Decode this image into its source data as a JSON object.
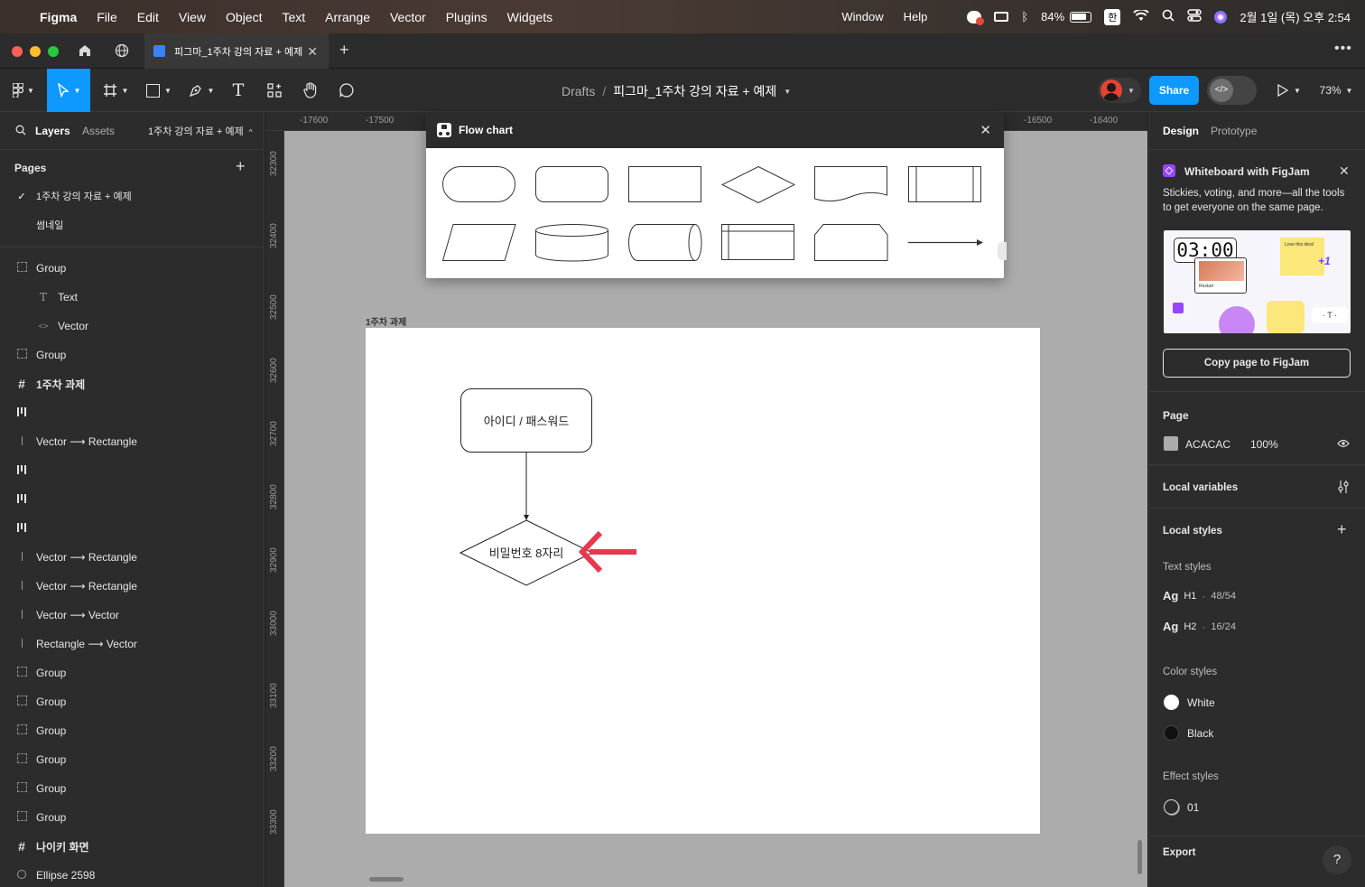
{
  "menubar": {
    "app": "Figma",
    "items": [
      "File",
      "Edit",
      "View",
      "Object",
      "Text",
      "Arrange",
      "Vector",
      "Plugins",
      "Widgets"
    ],
    "right_items": [
      "Window",
      "Help"
    ],
    "battery": "84%",
    "ime": "한",
    "datetime": "2월 1일 (목) 오후 2:54"
  },
  "tabs": {
    "active": "피그마_1주차 강의 자료 + 예제"
  },
  "toolbar": {
    "breadcrumb_root": "Drafts",
    "breadcrumb_sep": "/",
    "file_name": "피그마_1주차 강의 자료 + 예제",
    "share": "Share",
    "zoom": "73%"
  },
  "left": {
    "tab_layers": "Layers",
    "tab_assets": "Assets",
    "page_selector": "1주차 강의 자료 + 예제",
    "pages_title": "Pages",
    "pages": [
      "1주차 강의 자료 + 예제",
      "썸네일"
    ],
    "layers": [
      {
        "icon": "group-icon",
        "label": "Group",
        "indent": 0
      },
      {
        "icon": "text-icon",
        "label": "Text",
        "indent": 1
      },
      {
        "icon": "vector-icon",
        "label": "Vector",
        "indent": 1
      },
      {
        "icon": "group-icon",
        "label": "Group",
        "indent": 0
      },
      {
        "icon": "frame-icon",
        "label": "1주차 과제",
        "indent": 0,
        "bold": true
      },
      {
        "icon": "component-icon",
        "label": "",
        "indent": 0
      },
      {
        "icon": "line-icon",
        "label": "Vector ⟶ Rectangle",
        "indent": 0
      },
      {
        "icon": "component-icon",
        "label": "",
        "indent": 0
      },
      {
        "icon": "component-icon",
        "label": "",
        "indent": 0
      },
      {
        "icon": "component-icon",
        "label": "",
        "indent": 0
      },
      {
        "icon": "line-icon",
        "label": "Vector ⟶ Rectangle",
        "indent": 0
      },
      {
        "icon": "line-icon",
        "label": "Vector ⟶ Rectangle",
        "indent": 0
      },
      {
        "icon": "line-icon",
        "label": "Vector ⟶ Vector",
        "indent": 0
      },
      {
        "icon": "line-icon",
        "label": "Rectangle ⟶ Vector",
        "indent": 0
      },
      {
        "icon": "group-icon",
        "label": "Group",
        "indent": 0
      },
      {
        "icon": "group-icon",
        "label": "Group",
        "indent": 0
      },
      {
        "icon": "group-icon",
        "label": "Group",
        "indent": 0
      },
      {
        "icon": "group-icon",
        "label": "Group",
        "indent": 0
      },
      {
        "icon": "group-icon",
        "label": "Group",
        "indent": 0
      },
      {
        "icon": "group-icon",
        "label": "Group",
        "indent": 0
      },
      {
        "icon": "frame-icon",
        "label": "나이키 화면",
        "indent": 0,
        "bold": true
      },
      {
        "icon": "ellipse-icon",
        "label": "Ellipse 2598",
        "indent": 0
      }
    ]
  },
  "ruler": {
    "top": [
      "-17600",
      "-17500",
      "-16500",
      "-16400"
    ],
    "left": [
      "32300",
      "32400",
      "32500",
      "32600",
      "32700",
      "32800",
      "32900",
      "33000",
      "33100",
      "33200",
      "33300"
    ]
  },
  "canvas": {
    "frame_label": "1주차 과제",
    "node1": "아이디 / 패스워드",
    "node2": "비밀번호 8자리"
  },
  "flow_popup": {
    "title": "Flow chart"
  },
  "right": {
    "tab_design": "Design",
    "tab_prototype": "Prototype",
    "promo_title": "Whiteboard with FigJam",
    "promo_desc": "Stickies, voting, and more—all the tools to get everyone on the same page.",
    "promo_timer": "03:00",
    "promo_sticky": "Love this idea!",
    "promo_plus": "+1",
    "promo_restart": "Restart",
    "promo_button": "Copy page to FigJam",
    "page_title": "Page",
    "page_color": "ACACAC",
    "page_opacity": "100%",
    "page_color_hex": "#acacac",
    "local_variables": "Local variables",
    "local_styles": "Local styles",
    "text_styles": "Text styles",
    "text_style_items": [
      {
        "name": "H1",
        "spec": "48/54"
      },
      {
        "name": "H2",
        "spec": "16/24"
      }
    ],
    "color_styles": "Color styles",
    "color_items": [
      {
        "name": "White",
        "hex": "#ffffff"
      },
      {
        "name": "Black",
        "hex": "#111111"
      }
    ],
    "effect_styles": "Effect styles",
    "effect_items": [
      "01"
    ],
    "export": "Export",
    "help": "?"
  }
}
